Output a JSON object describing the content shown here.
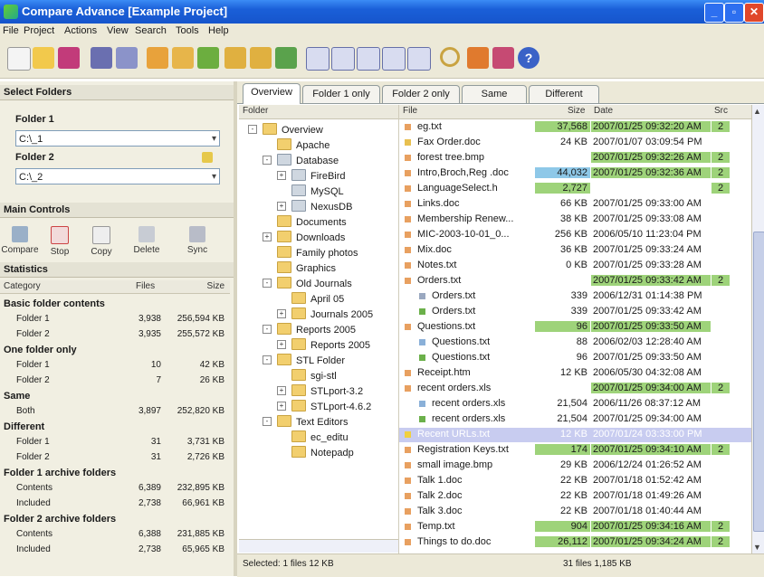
{
  "window": {
    "title": "Compare Advance [Example Project]"
  },
  "menu": [
    "File",
    "Project",
    "Actions",
    "View",
    "Search",
    "Tools",
    "Help"
  ],
  "toolbar_icons": [
    "new-icon",
    "open-icon",
    "save-icon",
    "save-as-icon",
    "options-icon",
    "compare-icon",
    "sync-icon",
    "filter-icon",
    "copy-left-icon",
    "copy-right-icon",
    "merge-icon",
    "checkbox-icon",
    "window-icon",
    "list-icon",
    "tree-icon",
    "grid-icon",
    "search-icon",
    "tools-icon",
    "bookmark-icon",
    "help-icon"
  ],
  "left": {
    "select_folders": "Select Folders",
    "folder1_label": "Folder 1",
    "folder1_value": "C:\\_1",
    "folder2_label": "Folder 2",
    "folder2_value": "C:\\_2",
    "main_controls": "Main Controls",
    "controls": [
      "Compare",
      "Stop",
      "Copy",
      "Delete",
      "Sync"
    ],
    "statistics": "Statistics",
    "stats_headers": [
      "Category",
      "Files",
      "Size"
    ],
    "stats": [
      {
        "label": "Basic folder contents",
        "group": true
      },
      {
        "label": "Folder 1",
        "files": "3,938",
        "size": "256,594 KB"
      },
      {
        "label": "Folder 2",
        "files": "3,935",
        "size": "255,572 KB"
      },
      {
        "label": "One folder only",
        "group": true
      },
      {
        "label": "Folder 1",
        "files": "10",
        "size": "42 KB"
      },
      {
        "label": "Folder 2",
        "files": "7",
        "size": "26 KB"
      },
      {
        "label": "Same",
        "group": true
      },
      {
        "label": "Both",
        "files": "3,897",
        "size": "252,820 KB"
      },
      {
        "label": "Different",
        "group": true
      },
      {
        "label": "Folder 1",
        "files": "31",
        "size": "3,731 KB"
      },
      {
        "label": "Folder 2",
        "files": "31",
        "size": "2,726 KB"
      },
      {
        "label": "Folder 1 archive folders",
        "group": true
      },
      {
        "label": "Contents",
        "files": "6,389",
        "size": "232,895 KB"
      },
      {
        "label": "Included",
        "files": "2,738",
        "size": "66,961 KB"
      },
      {
        "label": "Folder 2 archive folders",
        "group": true
      },
      {
        "label": "Contents",
        "files": "6,388",
        "size": "231,885 KB"
      },
      {
        "label": "Included",
        "files": "2,738",
        "size": "65,965 KB"
      }
    ]
  },
  "tabs": [
    "Overview",
    "Folder 1 only",
    "Folder 2 only",
    "Same",
    "Different"
  ],
  "tree": {
    "header": "Folder",
    "nodes": [
      {
        "label": "Overview",
        "indent": 0,
        "pm": "-"
      },
      {
        "label": "Apache",
        "indent": 1
      },
      {
        "label": "Database",
        "indent": 1,
        "pm": "-"
      },
      {
        "label": "FireBird",
        "indent": 2,
        "pm": "+"
      },
      {
        "label": "MySQL",
        "indent": 2
      },
      {
        "label": "NexusDB",
        "indent": 2,
        "pm": "+"
      },
      {
        "label": "Documents",
        "indent": 1
      },
      {
        "label": "Downloads",
        "indent": 1,
        "pm": "+"
      },
      {
        "label": "Family photos",
        "indent": 1
      },
      {
        "label": "Graphics",
        "indent": 1
      },
      {
        "label": "Old Journals",
        "indent": 1,
        "pm": "-"
      },
      {
        "label": "April 05",
        "indent": 2
      },
      {
        "label": "Journals 2005",
        "indent": 2,
        "pm": "+"
      },
      {
        "label": "Reports 2005",
        "indent": 1,
        "pm": "-"
      },
      {
        "label": "Reports 2005",
        "indent": 2,
        "pm": "+"
      },
      {
        "label": "STL Folder",
        "indent": 1,
        "pm": "-"
      },
      {
        "label": "sgi-stl",
        "indent": 2
      },
      {
        "label": "STLport-3.2",
        "indent": 2,
        "pm": "+"
      },
      {
        "label": "STLport-4.6.2",
        "indent": 2,
        "pm": "+"
      },
      {
        "label": "Text Editors",
        "indent": 1,
        "pm": "-"
      },
      {
        "label": "ec_editu",
        "indent": 2
      },
      {
        "label": "Notepadp",
        "indent": 2
      }
    ]
  },
  "files": {
    "headers": [
      "File",
      "Size",
      "Date",
      "Src"
    ],
    "rows": [
      {
        "name": "eg.txt",
        "size": "37,568",
        "date": "2007/01/25 09:32:20 AM",
        "src": "2",
        "hl": "g",
        "sizehl": "g",
        "c": "#e8a060"
      },
      {
        "name": "Fax Order.doc",
        "size": "24 KB",
        "date": "2007/01/07 03:09:54 PM",
        "c": "#e8c050"
      },
      {
        "name": "forest tree.bmp",
        "size": "",
        "date": "2007/01/25 09:32:26 AM",
        "src": "2",
        "hl": "g",
        "c": "#e8a060"
      },
      {
        "name": "Intro,Broch,Reg .doc",
        "size": "44,032",
        "date": "2007/01/25 09:32:36 AM",
        "src": "2",
        "hl": "g",
        "sizehl": "b",
        "c": "#e8a060"
      },
      {
        "name": "LanguageSelect.h",
        "size": "2,727",
        "date": "",
        "src": "2",
        "sizehl": "g",
        "c": "#e8a060"
      },
      {
        "name": "Links.doc",
        "size": "66 KB",
        "date": "2007/01/25 09:33:00 AM",
        "c": "#e8a060"
      },
      {
        "name": "Membership Renew...",
        "size": "38 KB",
        "date": "2007/01/25 09:33:08 AM",
        "c": "#e8a060"
      },
      {
        "name": "MIC-2003-10-01_0...",
        "size": "256 KB",
        "date": "2006/05/10 11:23:04 PM",
        "c": "#e8a060"
      },
      {
        "name": "Mix.doc",
        "size": "36 KB",
        "date": "2007/01/25 09:33:24 AM",
        "c": "#e8a060"
      },
      {
        "name": "Notes.txt",
        "size": "0 KB",
        "date": "2007/01/25 09:33:28 AM",
        "c": "#e8a060"
      },
      {
        "name": "Orders.txt",
        "size": "",
        "date": "2007/01/25 09:33:42 AM",
        "src": "2",
        "hl": "g",
        "c": "#e8a060"
      },
      {
        "name": "Orders.txt",
        "size": "339",
        "date": "2006/12/31 01:14:38 PM",
        "indent": true,
        "c": "#9aa8c0"
      },
      {
        "name": "Orders.txt",
        "size": "339",
        "date": "2007/01/25 09:33:42 AM",
        "indent": true,
        "c": "#6bb04a"
      },
      {
        "name": "Questions.txt",
        "size": "96",
        "date": "2007/01/25 09:33:50 AM",
        "hl": "g",
        "sizehl": "g",
        "c": "#e8a060"
      },
      {
        "name": "Questions.txt",
        "size": "88",
        "date": "2006/02/03 12:28:40 AM",
        "indent": true,
        "c": "#8ab0d8"
      },
      {
        "name": "Questions.txt",
        "size": "96",
        "date": "2007/01/25 09:33:50 AM",
        "indent": true,
        "c": "#6bb04a"
      },
      {
        "name": "Receipt.htm",
        "size": "12 KB",
        "date": "2006/05/30 04:32:08 AM",
        "c": "#e8a060"
      },
      {
        "name": "recent orders.xls",
        "size": "",
        "date": "2007/01/25 09:34:00 AM",
        "src": "2",
        "hl": "g",
        "c": "#e8a060"
      },
      {
        "name": "recent orders.xls",
        "size": "21,504",
        "date": "2006/11/26 08:37:12 AM",
        "indent": true,
        "c": "#8ab0d8"
      },
      {
        "name": "recent orders.xls",
        "size": "21,504",
        "date": "2007/01/25 09:34:00 AM",
        "indent": true,
        "c": "#6bb04a"
      },
      {
        "name": "Recent URLs.txt",
        "size": "12 KB",
        "date": "2007/01/24 03:33:00 PM",
        "selected": true,
        "c": "#f0d040"
      },
      {
        "name": "Registration Keys.txt",
        "size": "174",
        "date": "2007/01/25 09:34:10 AM",
        "src": "2",
        "hl": "g",
        "sizehl": "g",
        "c": "#e8a060"
      },
      {
        "name": "small image.bmp",
        "size": "29 KB",
        "date": "2006/12/24 01:26:52 AM",
        "c": "#e8a060"
      },
      {
        "name": "Talk 1.doc",
        "size": "22 KB",
        "date": "2007/01/18 01:52:42 AM",
        "c": "#e8a060"
      },
      {
        "name": "Talk 2.doc",
        "size": "22 KB",
        "date": "2007/01/18 01:49:26 AM",
        "c": "#e8a060"
      },
      {
        "name": "Talk 3.doc",
        "size": "22 KB",
        "date": "2007/01/18 01:40:44 AM",
        "c": "#e8a060"
      },
      {
        "name": "Temp.txt",
        "size": "904",
        "date": "2007/01/25 09:34:16 AM",
        "src": "2",
        "hl": "g",
        "sizehl": "g",
        "c": "#e8a060"
      },
      {
        "name": "Things to do.doc",
        "size": "26,112",
        "date": "2007/01/25 09:34:24 AM",
        "src": "2",
        "hl": "g",
        "sizehl": "g",
        "c": "#e8a060"
      }
    ]
  },
  "status": {
    "left": "Selected: 1 files 12 KB",
    "right": "31 files 1,185 KB"
  }
}
